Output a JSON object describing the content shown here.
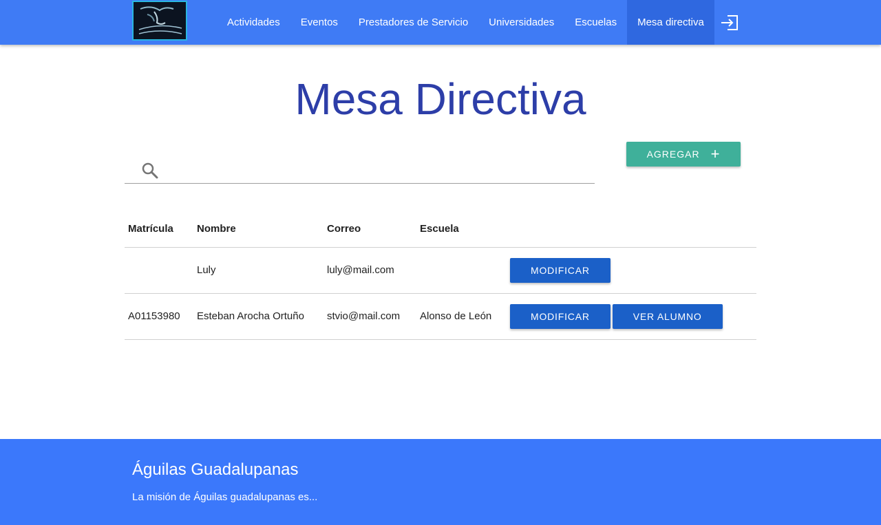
{
  "nav": {
    "logo_alt": "Águilas Guadalupanas",
    "items": [
      {
        "label": "Actividades"
      },
      {
        "label": "Eventos"
      },
      {
        "label": "Prestadores de Servicio"
      },
      {
        "label": "Universidades"
      },
      {
        "label": "Escuelas"
      },
      {
        "label": "Mesa directiva",
        "active": true
      }
    ],
    "logout_icon": "logout-icon"
  },
  "main": {
    "title": "Mesa Directiva",
    "search": {
      "placeholder": "",
      "value": ""
    },
    "add_button": "AGREGAR",
    "table": {
      "headers": [
        "Matrícula",
        "Nombre",
        "Correo",
        "Escuela"
      ],
      "rows": [
        {
          "matricula": "",
          "nombre": "Luly",
          "correo": "luly@mail.com",
          "escuela": "",
          "actions": [
            "MODIFICAR"
          ]
        },
        {
          "matricula": "A01153980",
          "nombre": "Esteban Arocha Ortuño",
          "correo": "stvio@mail.com",
          "escuela": "Alonso de León",
          "actions": [
            "MODIFICAR",
            "VER ALUMNO"
          ]
        }
      ]
    }
  },
  "footer": {
    "title": "Águilas Guadalupanas",
    "text": "La misión de Águilas guadalupanas es..."
  },
  "colors": {
    "navbar": "#3f7bf5",
    "title": "#2d3ea8",
    "add_button": "#3fb09a",
    "action_button": "#1b60c8",
    "footer": "#3b78fb"
  }
}
